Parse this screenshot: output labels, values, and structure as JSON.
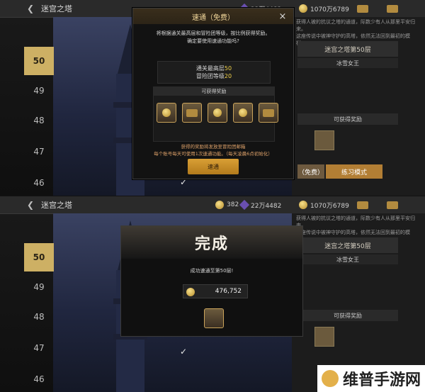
{
  "top_panel": {
    "title": "迷宫之塔",
    "resources": {
      "coins": "1070万6789",
      "gems": "22万4482"
    },
    "floors": [
      "50",
      "49",
      "48",
      "47",
      "46"
    ],
    "selected_floor": "50",
    "info": {
      "desc_lines": [
        "获得人被的抗议之塔的通道，际数少有人从那里平安归来。",
        "这座传说中被神守护的高塔，依然无法回到最初的模样。"
      ],
      "floor_title": "迷宫之塔第50层",
      "boss_name": "冰雪女王",
      "reward_label": "可获得奖励"
    },
    "buttons": {
      "left": "（免费）",
      "right": "练习模式"
    },
    "modal": {
      "title": "速通（免费）",
      "close_symbol": "×",
      "text_lines": [
        "将根据通关最高层和冒险团等级，按比例获得奖励。",
        "确定要使用速通功能吗?"
      ],
      "stat1_label": "通关最高层",
      "stat1_value": "50",
      "stat2_label": "冒险团等级",
      "stat2_value": "20",
      "reward_label": "可获得奖励",
      "note_lines": [
        "获得的奖励将发放至冒险团邮箱",
        "每个账号每天可使用1次速通功能。（每天凌晨6点初始化）"
      ],
      "confirm": "速通"
    }
  },
  "bottom_panel": {
    "title": "迷宫之塔",
    "resources": {
      "coins": "1070万6789",
      "gems": "22万4482",
      "level": "382"
    },
    "floors": [
      "50",
      "49",
      "48",
      "47",
      "46"
    ],
    "selected_floor": "50",
    "info": {
      "desc_lines": [
        "获得人被的抗议之塔的通道，际数少有人从那里平安归来。",
        "这座传说中被神守护的高塔，依然无法回到最初的模样。"
      ],
      "floor_title": "迷宫之塔第50层",
      "boss_name": "冰雪女王",
      "reward_label": "可获得奖励"
    },
    "complete": {
      "header": "完成",
      "success_text": "成功速通至第50层!",
      "amount": "476,752"
    }
  },
  "watermark": "维普手游网"
}
